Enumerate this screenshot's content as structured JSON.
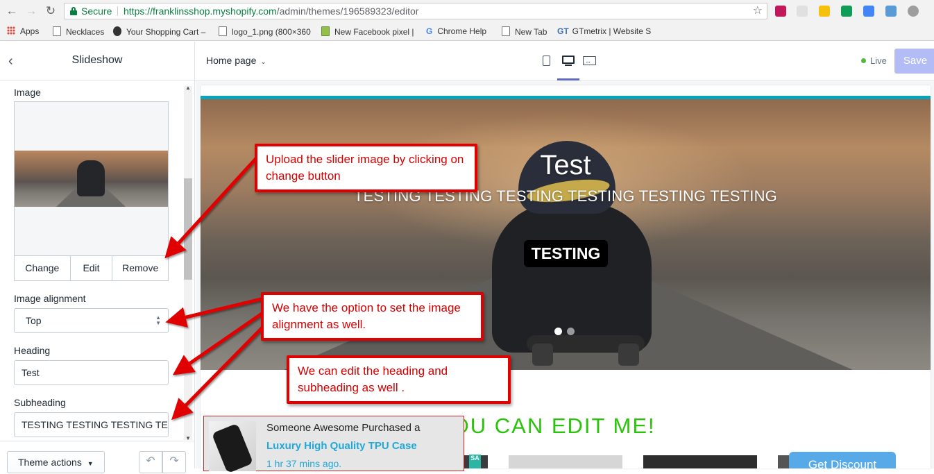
{
  "browser": {
    "secure_label": "Secure",
    "url_host": "https://franklinsshop.myshopify.com",
    "url_path": "/admin/themes/196589323/editor",
    "bookmarks": [
      "Apps",
      "Necklaces",
      "Your Shopping Cart –",
      "logo_1.png (800×360",
      "New Facebook pixel |",
      "Chrome Help",
      "New Tab",
      "GTmetrix | Website S"
    ]
  },
  "sidebar": {
    "title": "Slideshow",
    "image_label": "Image",
    "image_buttons": {
      "change": "Change",
      "edit": "Edit",
      "remove": "Remove"
    },
    "alignment_label": "Image alignment",
    "alignment_value": "Top",
    "heading_label": "Heading",
    "heading_value": "Test",
    "subheading_label": "Subheading",
    "subheading_value": "TESTING TESTING TESTING TEST",
    "theme_actions": "Theme actions"
  },
  "topbar": {
    "page_select": "Home page",
    "live_label": "Live",
    "save_label": "Save"
  },
  "preview": {
    "hero_title": "Test",
    "hero_subtitle": "TESTING TESTING TESTING TESTING TESTING TESTING",
    "hero_button": "TESTING",
    "section_heading": "YOU CAN EDIT ME!",
    "discount_button": "Get Discount",
    "sale_tag": "SA"
  },
  "popup": {
    "line1": "Someone Awesome Purchased a",
    "product": "Luxury High Quality TPU Case",
    "time": "1 hr 37 mins ago."
  },
  "annotations": {
    "upload": "Upload the slider image by clicking on change button",
    "alignment": "We have the option to set the image alignment as well.",
    "heading": "We can edit the heading and subheading as well ."
  },
  "colors": {
    "annotation_red": "#e10000",
    "accent_indigo": "#5c6ac4",
    "save_disabled": "#b3bcf5",
    "heading_green": "#29c40a",
    "strip_teal": "#0ca4b8",
    "popup_link": "#1fa8d8"
  }
}
